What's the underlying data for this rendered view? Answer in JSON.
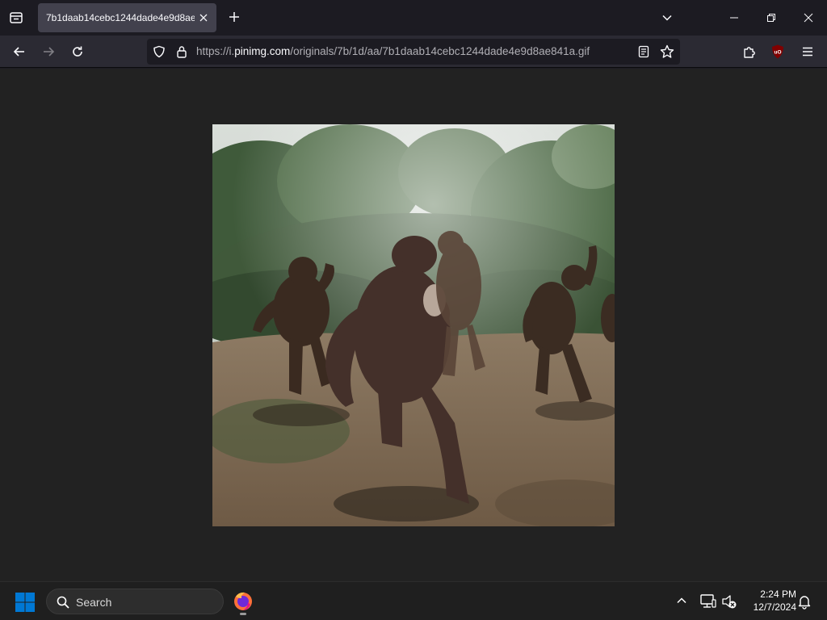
{
  "browser": {
    "tab": {
      "title": "7b1daab14cebc1244dade4e9d8ae841a.gif"
    },
    "url": {
      "scheme": "https://i.",
      "host": "pinimg.com",
      "path": "/originals/7b/1d/aa/7b1daab14cebc1244dade4e9d8ae841a.gif"
    },
    "extensions": {
      "ublock_label": "uO"
    },
    "colors": {
      "tab_active": "#42414d",
      "toolbar": "#2b2a33",
      "urlbar": "#1c1b22",
      "ublock": "#800000"
    }
  },
  "content": {
    "image": {
      "icon": "dancing-gorillas-gif"
    },
    "background": "#222222"
  },
  "taskbar": {
    "search_label": "Search",
    "clock": {
      "time": "2:24 PM",
      "date": "12/7/2024"
    },
    "accent": "#0078d4"
  }
}
